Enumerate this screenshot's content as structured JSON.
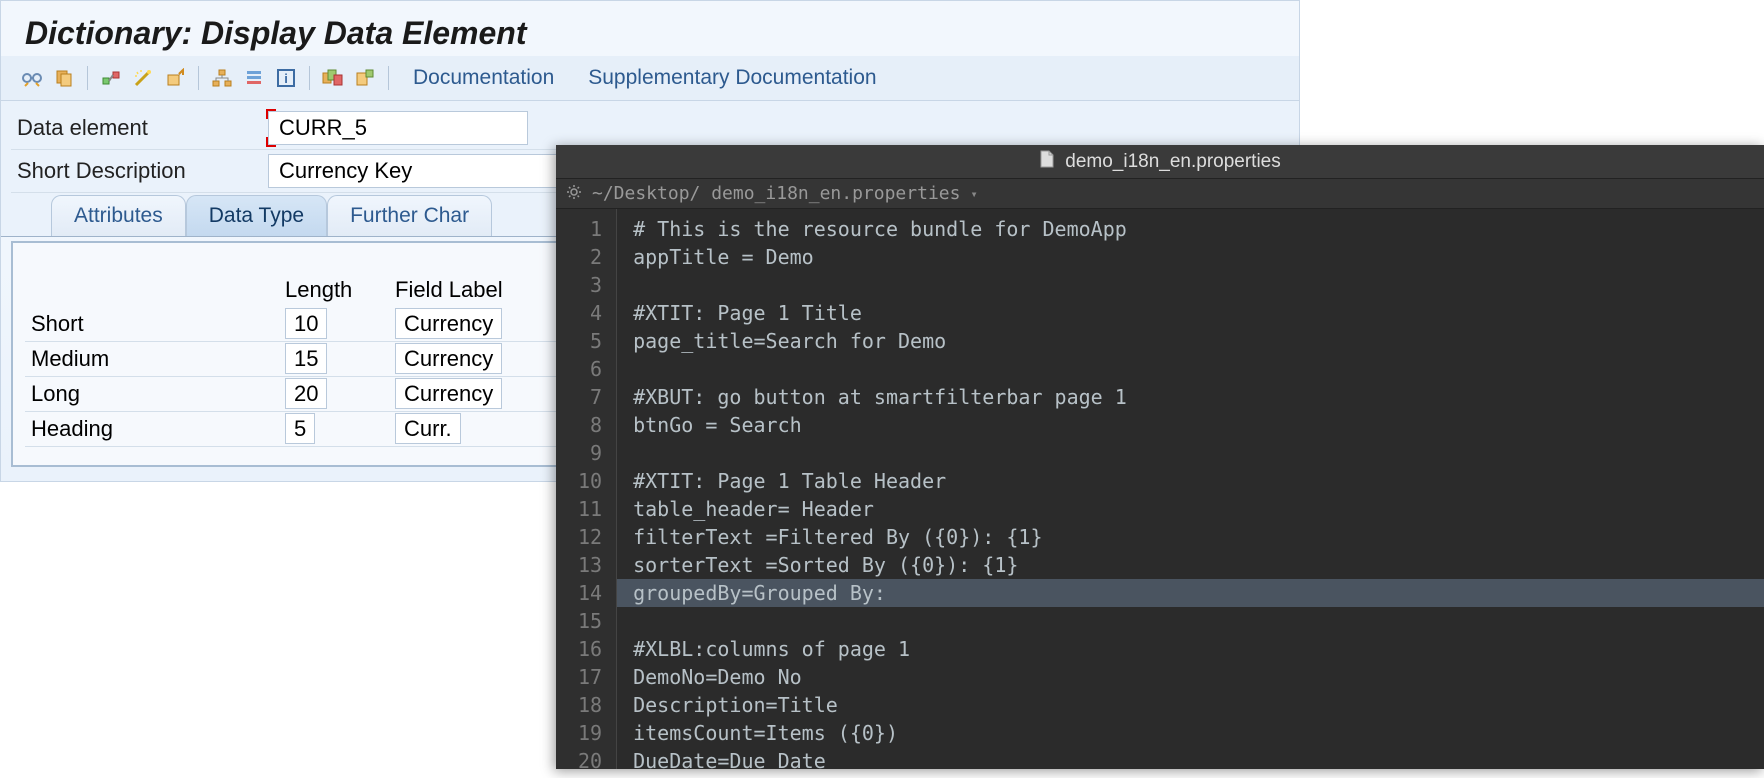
{
  "sap": {
    "title": "Dictionary: Display Data Element",
    "toolbar": {
      "documentation": "Documentation",
      "supplementary": "Supplementary Documentation"
    },
    "form": {
      "data_element_label": "Data element",
      "data_element_value": "CURR_5",
      "short_desc_label": "Short Description",
      "short_desc_value": "Currency Key"
    },
    "tabs": {
      "attributes": "Attributes",
      "data_type": "Data Type",
      "further": "Further Char"
    },
    "grid": {
      "header_length": "Length",
      "header_field_label": "Field Label",
      "rows": [
        {
          "label": "Short",
          "length": "10",
          "field": "Currency"
        },
        {
          "label": "Medium",
          "length": "15",
          "field": "Currency"
        },
        {
          "label": "Long",
          "length": "20",
          "field": "Currency"
        },
        {
          "label": "Heading",
          "length": "5",
          "field": "Curr."
        }
      ]
    }
  },
  "editor": {
    "window_title": "demo_i18n_en.properties",
    "path": "~/Desktop/ demo_i18n_en.properties",
    "highlight_line": 14,
    "lines": [
      "# This is the resource bundle for DemoApp",
      "appTitle = Demo",
      "",
      "#XTIT: Page 1 Title",
      "page_title=Search for Demo",
      "",
      "#XBUT: go button at smartfilterbar page 1",
      "btnGo = Search",
      "",
      "#XTIT: Page 1 Table Header",
      "table_header= Header",
      "filterText =Filtered By ({0}): {1}",
      "sorterText =Sorted By ({0}): {1}",
      "groupedBy=Grouped By:",
      "",
      "#XLBL:columns of page 1",
      "DemoNo=Demo No",
      "Description=Title",
      "itemsCount=Items ({0})",
      "DueDate=Due Date"
    ]
  }
}
